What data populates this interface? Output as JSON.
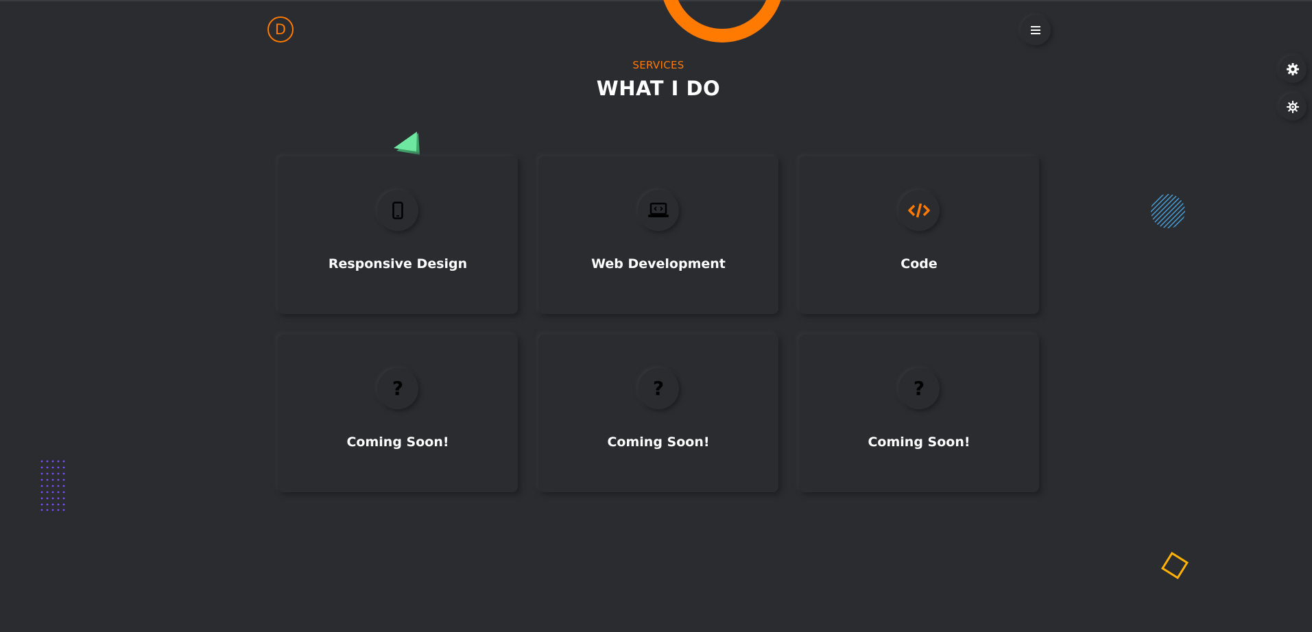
{
  "header": {
    "logo_letter": "D",
    "menu_icon": "hamburger-icon"
  },
  "side_tools": [
    {
      "icon": "gear-icon"
    },
    {
      "icon": "sun-gear-icon"
    }
  ],
  "section": {
    "eyebrow": "SERVICES",
    "title": "WHAT I DO"
  },
  "services": [
    {
      "title": "Responsive Design",
      "icon": "smartphone-icon"
    },
    {
      "title": "Web Development",
      "icon": "laptop-code-icon"
    },
    {
      "title": "Code",
      "icon": "code-icon"
    },
    {
      "title": "Coming Soon!",
      "icon": "question-icon"
    },
    {
      "title": "Coming Soon!",
      "icon": "question-icon"
    },
    {
      "title": "Coming Soon!",
      "icon": "question-icon"
    }
  ],
  "colors": {
    "background": "#2b2c30",
    "accent": "#ff7a00",
    "text": "#ffffff"
  }
}
